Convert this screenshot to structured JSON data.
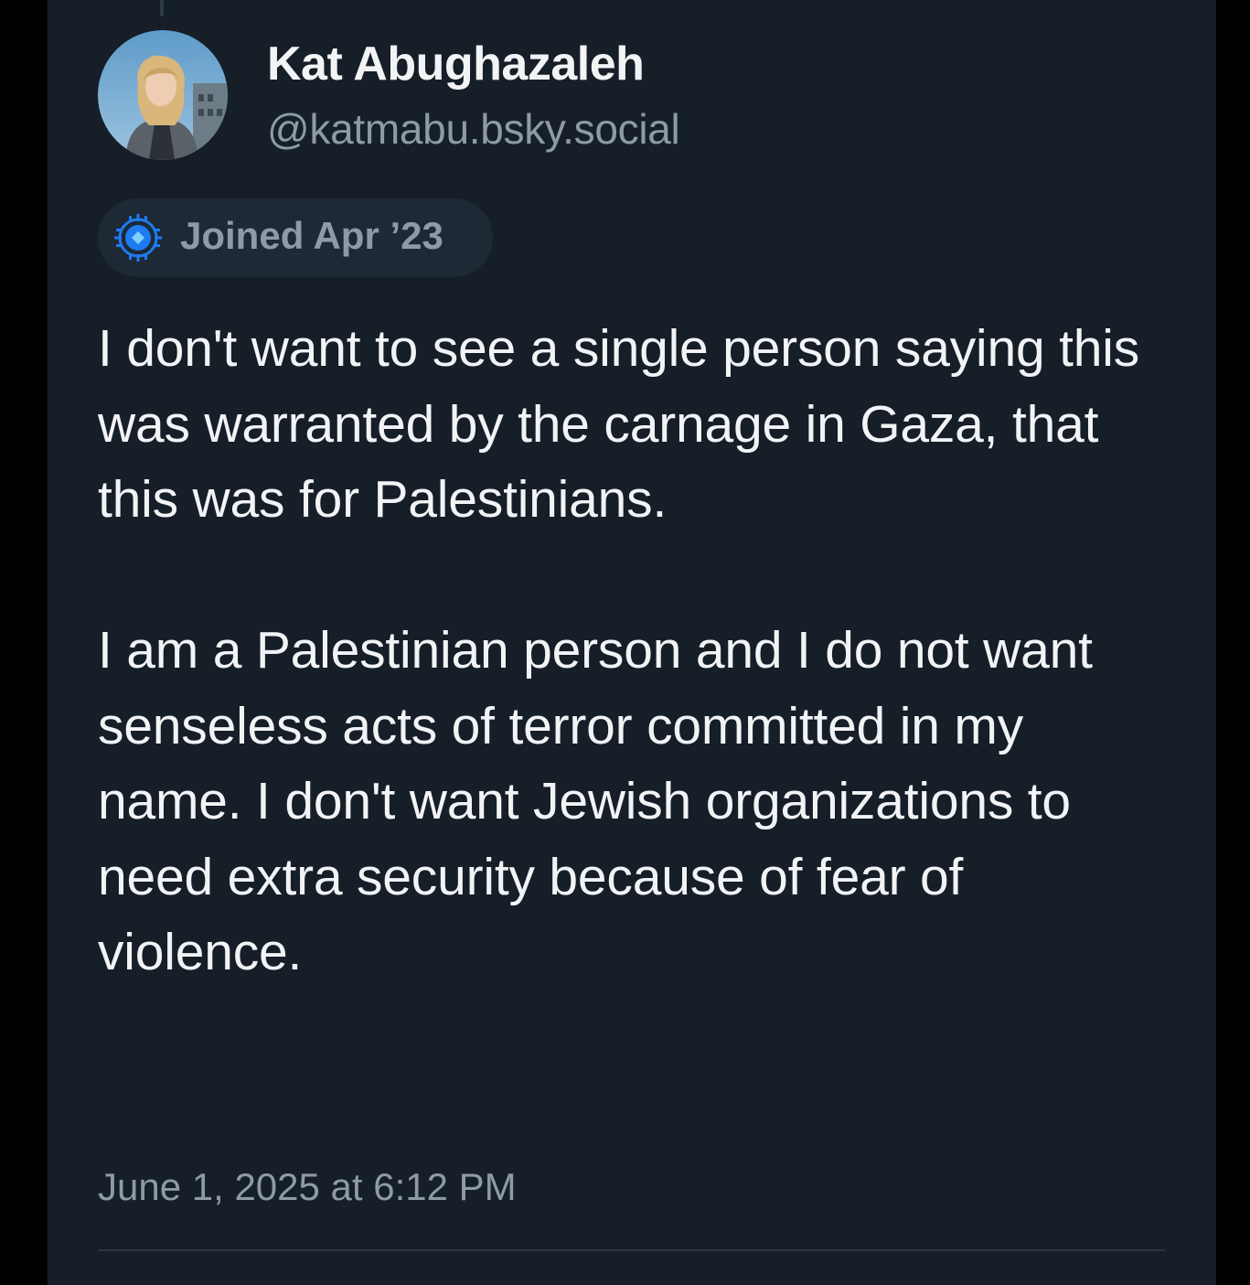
{
  "post": {
    "author": {
      "display_name": "Kat Abughazaleh",
      "handle": "@katmabu.bsky.social",
      "avatar_icon": "profile-photo",
      "joined_label": "Joined Apr ’23",
      "badge_icon": "bluesky-verified-badge-icon"
    },
    "text": "I don't want to see a single person saying this was warranted by the carnage in Gaza, that this was for Palestinians.\n\nI am a Palestinian person and I do not want senseless acts of terror committed in my name. I don't want Jewish organizations to need extra security because of fear of violence.",
    "timestamp": "June 1, 2025 at 6:12 PM"
  },
  "colors": {
    "background": "#000000",
    "panel": "#161e27",
    "text_primary": "#f1f3f5",
    "text_secondary": "#8d9aa8",
    "badge_bg": "#1e2936",
    "badge_accent": "#1e7bf0"
  }
}
